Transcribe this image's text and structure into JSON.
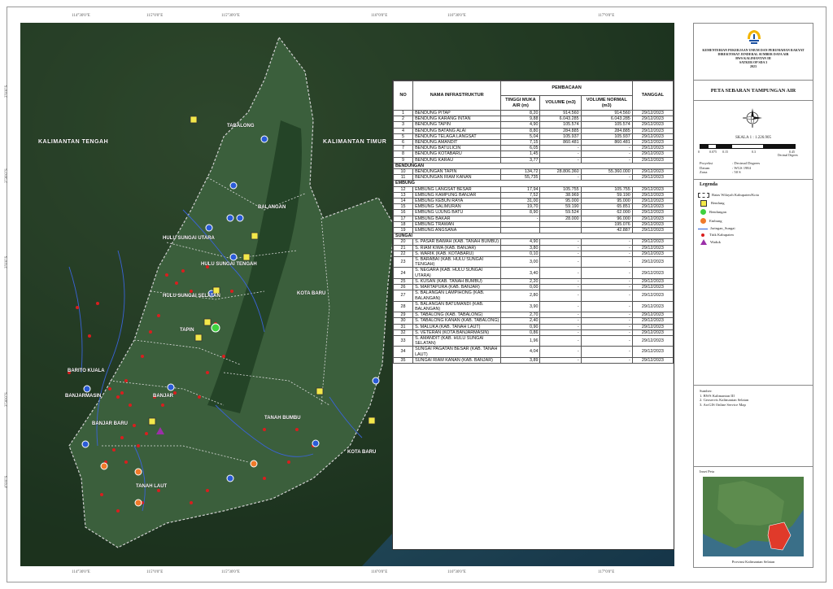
{
  "ministry_lines": [
    "KEMENTERIAN PEKERJAAN UMUM DAN PERUMAHAN RAKYAT",
    "DIREKTORAT JENDERAL SUMBER DAYA AIR",
    "BWS KALIMANTAN III",
    "SATKER OP SDA 3",
    "2023"
  ],
  "map_title": "PETA SEBARAN TAMPUNGAN AIR",
  "scale_text": "SKALA 1 : 1.226.905",
  "scale_ticks": [
    "0",
    "0.075",
    "0.15",
    "0.3",
    "0.45"
  ],
  "scale_unit": "Decimal Degrees",
  "projection": [
    {
      "k": "Proyeksi",
      "v": ": Decimal Degrees"
    },
    {
      "k": "Datum",
      "v": ": WGS 1984"
    },
    {
      "k": "Zona",
      "v": ": 50 S"
    }
  ],
  "legend_title": "Legenda",
  "legend": [
    {
      "label": "Batas Wilayah Kabupaten/Kota",
      "icon": "boundary-icon"
    },
    {
      "label": "Bendung",
      "icon": "bendung-icon",
      "color": "#f3e84a"
    },
    {
      "label": "Bendungan",
      "icon": "bendungan-icon",
      "color": "#3fd13f"
    },
    {
      "label": "Embung",
      "icon": "embung-icon",
      "color": "#f07a2a"
    },
    {
      "label": "Jaringan_Sungai",
      "icon": "river-icon",
      "color": "#2a5bd7"
    },
    {
      "label": "Titik Kabupaten",
      "icon": "red-dot-icon",
      "color": "#d91e1e"
    },
    {
      "label": "Waduk",
      "icon": "triangle-icon",
      "color": "#9b2fa8"
    }
  ],
  "sources_title": "Sumber:",
  "sources": [
    "1. BWS Kalimantan III",
    "2. Geoservis Kalimantan Selatan",
    "3. ArcGIS Online Service Map"
  ],
  "inset_title": "Inset Peta",
  "inset_caption": "Provinsi Kalimantan Selatan",
  "top_coords": [
    "114°30'0\"E",
    "115°0'0\"E",
    "115°30'0\"E",
    "116°0'0\"E",
    "116°30'0\"E",
    "117°0'0\"E"
  ],
  "bottom_coords": [
    "114°30'0\"E",
    "115°0'0\"E",
    "115°30'0\"E",
    "116°0'0\"E",
    "116°30'0\"E",
    "117°0'0\"E"
  ],
  "left_coords": [
    "2°0'0\"S",
    "2°30'0\"S",
    "3°0'0\"S",
    "3°30'0\"S",
    "4°0'0\"S"
  ],
  "map_labels": {
    "kalteng_left": "KALIMANTAN TENGAH",
    "kalteng_right": "KALIMANTAN TIMUR",
    "tabalong": "TABALONG",
    "balangan": "BALANGAN",
    "hsu": "HULU SUNGAI UTARA",
    "hst": "HULU SUNGAI TENGAH",
    "hss": "HULU SUNGAI SELATAN",
    "tapin": "TAPIN",
    "kotabaru1": "KOTA BARU",
    "kotabaru2": "KOTA BARU",
    "batola": "BARITO KUALA",
    "bjm": "BANJARMASIN",
    "banjar": "BANJAR",
    "bjb": "BANJAR BARU",
    "tanahlaut": "TANAH LAUT",
    "tanahbumbu": "TANAH BUMBU"
  },
  "table": {
    "head": {
      "no": "NO",
      "name": "NAMA INFRASTRUKTUR",
      "group": "PEMBACAAN",
      "tma": "TINGGI MUKA AIR (m)",
      "vol": "VOLUME (m3)",
      "volnorm": "VOLUME NORMAL (m3)",
      "date": "TANGGAL"
    },
    "sections": [
      {
        "title": "",
        "rows": [
          [
            "1",
            "BENDUNG PITAP",
            "8,20",
            "914.560",
            "914.560",
            "29/12/2023"
          ],
          [
            "2",
            "BENDUNG KARANG INTAN",
            "9,88",
            "6.043.285",
            "6.043.285",
            "29/12/2023"
          ],
          [
            "3",
            "BENDUNG TAPIN",
            "4,90",
            "105.574",
            "105.574",
            "29/12/2023"
          ],
          [
            "4",
            "BENDUNG BATANG ALAI",
            "8,80",
            "284.885",
            "284.885",
            "29/12/2023"
          ],
          [
            "5",
            "BENDUNG TELAGA LANGSAT",
            "5,04",
            "105.937",
            "105.937",
            "29/12/2023"
          ],
          [
            "6",
            "BENDUNG AMANDIT",
            "7,15",
            "860.481",
            "860.481",
            "29/12/2023"
          ],
          [
            "7",
            "BENDUNG BATULICIN",
            "6,05",
            "-",
            "-",
            "29/12/2023"
          ],
          [
            "8",
            "BENDUNG KOTABARU",
            "1,45",
            "-",
            "-",
            "29/12/2023"
          ],
          [
            "9",
            "BENDUNG KARAU",
            "3,77",
            "-",
            "-",
            "29/12/2023"
          ]
        ]
      },
      {
        "title": "BENDUNGAN",
        "rows": [
          [
            "10",
            "BENDUNGAN TAPIN",
            "134,72",
            "28.806.360",
            "55.360.000",
            "29/12/2023"
          ],
          [
            "11",
            "BENDUNGAN RIAM KANAN",
            "55,735",
            "-",
            "-",
            "29/12/2023"
          ]
        ]
      },
      {
        "title": "EMBUNG",
        "rows": [
          [
            "12",
            "EMBUNG LANGSAT BESAR",
            "17,94",
            "105.755",
            "105.755",
            "29/12/2023"
          ],
          [
            "13",
            "EMBUNG KAMPUNG BANJAR",
            "7,52",
            "38.969",
            "59.190",
            "29/12/2023"
          ],
          [
            "14",
            "EMBUNG KEBUN RAYA",
            "31,00",
            "95.000",
            "95.000",
            "29/12/2023"
          ],
          [
            "15",
            "EMBUNG SALIMURAN",
            "19,70",
            "59.190",
            "65.851",
            "29/12/2023"
          ],
          [
            "16",
            "EMBUNG UJUNG BATU",
            "8,90",
            "59.524",
            "62.000",
            "29/12/2023"
          ],
          [
            "17",
            "EMBUNG BAKAR",
            "-",
            "28.000",
            "96.000",
            "29/12/2023"
          ],
          [
            "18",
            "EMBUNG TRAWAN",
            "",
            "",
            "195.076",
            "29/12/2023"
          ],
          [
            "19",
            "EMBUNG ANGSANA",
            "",
            "",
            "42.887",
            "29/12/2023"
          ]
        ]
      },
      {
        "title": "SUNGAI",
        "rows": [
          [
            "20",
            "S. PASAR BAWAH (KAB. TANAH BUMBU)",
            "4,90",
            "-",
            "-",
            "29/12/2023"
          ],
          [
            "21",
            "S. RIAM KIWA (KAB. BANJAR)",
            "3,80",
            "-",
            "-",
            "29/12/2023"
          ],
          [
            "22",
            "S. WARIK (KAB. KOTABARU)",
            "0,10",
            "-",
            "-",
            "29/12/2023"
          ],
          [
            "23",
            "S. BARABAI (KAB. HULU SUNGAI TENGAH)",
            "3,00",
            "-",
            "-",
            "29/12/2023"
          ],
          [
            "24",
            "S. NEGARA (KAB. HULU SUNGAI UTARA)",
            "3,40",
            "-",
            "-",
            "29/12/2023"
          ],
          [
            "25",
            "S. KUSAN (KAB. TANAH BUMBU)",
            "2,20",
            "-",
            "-",
            "29/12/2023"
          ],
          [
            "26",
            "S. MARTAPURA (KAB. BANJAR)",
            "0,00",
            "-",
            "-",
            "29/12/2023"
          ],
          [
            "27",
            "S. BALANGAN LAMPIHONG (KAB. BALANGAN)",
            "2,80",
            "-",
            "-",
            "29/12/2023"
          ],
          [
            "28",
            "S. BALANGAN BATUMANDI (KAB. BALANGAN)",
            "3,90",
            "-",
            "-",
            "29/12/2023"
          ],
          [
            "29",
            "S. TABALONG (KAB. TABALONG)",
            "2,70",
            "-",
            "-",
            "29/12/2023"
          ],
          [
            "30",
            "S. TABALONG KANAN (KAB. TABALONG)",
            "2,40",
            "-",
            "-",
            "29/12/2023"
          ],
          [
            "31",
            "S. MALUKA (KAB. TANAH LAUT)",
            "0,90",
            "-",
            "-",
            "29/12/2023"
          ],
          [
            "32",
            "S. VETERAN (KOTA BANJARMASIN)",
            "0,86",
            "-",
            "-",
            "29/12/2023"
          ],
          [
            "33",
            "S. AMANDIT (KAB. HULU SUNGAI SELATAN)",
            "1,96",
            "-",
            "-",
            "29/12/2023"
          ],
          [
            "34",
            "SUNGAI PAGATAN BESAR (KAB. TANAH LAUT)",
            "4,04",
            "-",
            "-",
            "29/12/2023"
          ],
          [
            "35",
            "SUNGAI RIAM KANAN (KAB. BANJAR)",
            "3,89",
            "-",
            "-",
            "29/12/2023"
          ]
        ]
      }
    ]
  }
}
